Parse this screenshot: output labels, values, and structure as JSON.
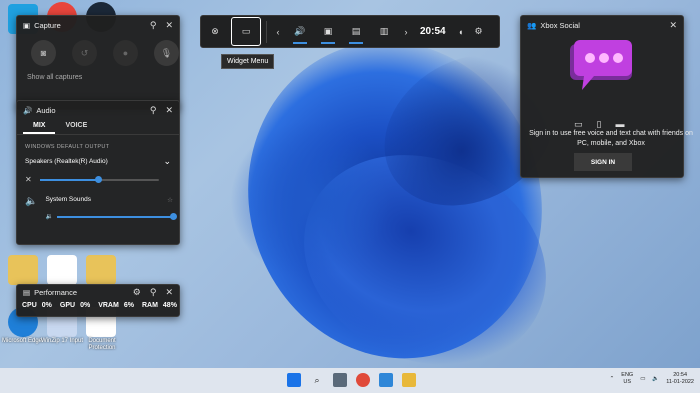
{
  "capture": {
    "title": "Capture",
    "pin_icon": "pin-icon",
    "close_icon": "close-icon",
    "buttons": [
      "screenshot-icon",
      "record-last-icon",
      "record-icon",
      "mic-off-icon"
    ],
    "hidden_text": "Show all captures"
  },
  "audio": {
    "title": "Audio",
    "tabs": [
      "MIX",
      "VOICE"
    ],
    "default_output_label": "WINDOWS DEFAULT OUTPUT",
    "device": "Speakers (Realtek(R) Audio)",
    "master_volume": 0.49,
    "app_name": "System Sounds",
    "app_volume": 1.0
  },
  "performance": {
    "title": "Performance",
    "metrics": [
      {
        "label": "CPU",
        "value": "0%"
      },
      {
        "label": "GPU",
        "value": "0%"
      },
      {
        "label": "VRAM",
        "value": "6%"
      },
      {
        "label": "RAM",
        "value": "48%"
      }
    ]
  },
  "gamebar": {
    "time": "20:54",
    "tooltip": "Widget Menu",
    "accent": "#3d8fe0"
  },
  "social": {
    "title": "Xbox Social",
    "description": "Sign in to use free voice and text chat with friends on PC, mobile, and Xbox",
    "signin_label": "SIGN IN"
  },
  "taskbar": {
    "lang1": "ENG",
    "lang2": "US",
    "time": "20:54",
    "date": "11-01-2022"
  },
  "desktop": {
    "labels": [
      "Microsoft Edge",
      "WinZip 17 Input",
      "Document Protection"
    ]
  }
}
